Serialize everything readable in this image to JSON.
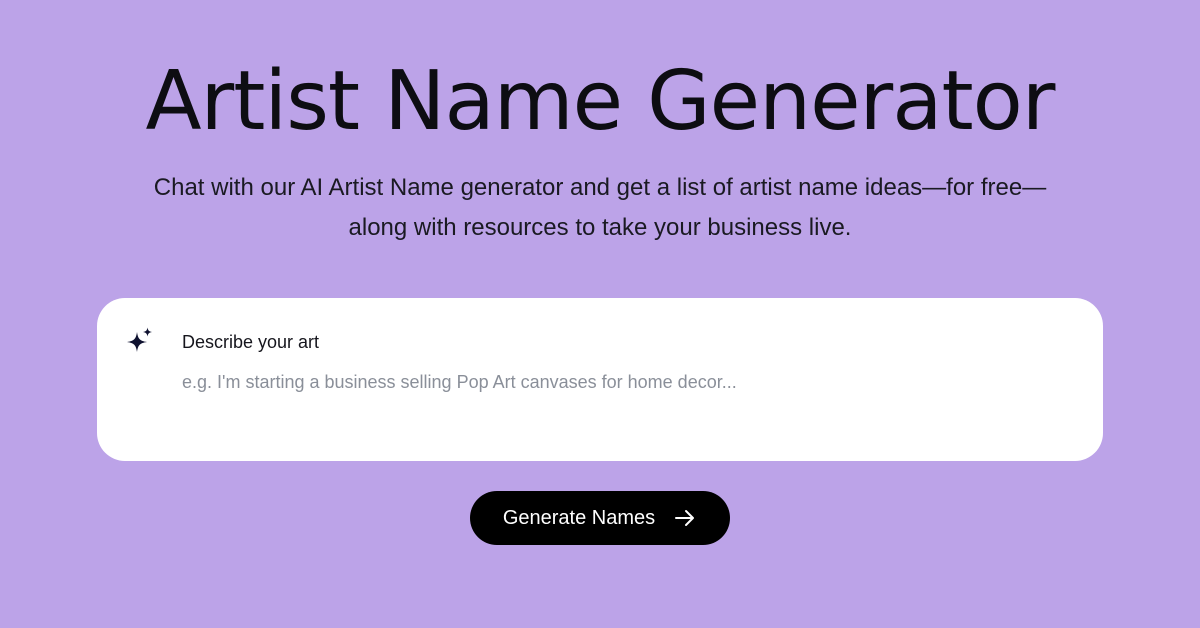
{
  "hero": {
    "title": "Artist Name Generator",
    "subtitle_line1": "Chat with our AI Artist Name generator and get a list of artist name ideas—for free—",
    "subtitle_line2": "along with resources to take your business live."
  },
  "prompt": {
    "icon": "sparkle-icon",
    "label": "Describe your art",
    "value": "",
    "placeholder": "e.g. I'm starting a business selling Pop Art canvases for home decor..."
  },
  "generate_button": {
    "label": "Generate Names",
    "icon": "arrow-right-icon"
  },
  "colors": {
    "background": "#bca3e8",
    "card": "#ffffff",
    "button": "#000000",
    "button_text": "#ffffff",
    "placeholder": "#8a8f99"
  }
}
